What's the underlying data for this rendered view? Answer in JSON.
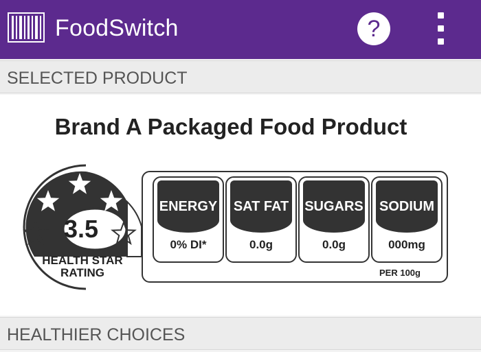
{
  "appbar": {
    "title": "FoodSwitch",
    "help_label": "?"
  },
  "selected": {
    "header": "SELECTED PRODUCT",
    "product_name": "Brand A Packaged Food Product",
    "health_star": {
      "value": "3.5",
      "rating": 3.5,
      "max": 5,
      "label_line1": "HEALTH STAR",
      "label_line2": "RATING"
    },
    "nutrients": [
      {
        "name": "ENERGY",
        "value": "0% DI*"
      },
      {
        "name": "SAT FAT",
        "value": "0.0g"
      },
      {
        "name": "SUGARS",
        "value": "0.0g"
      },
      {
        "name": "SODIUM",
        "value": "000mg"
      }
    ],
    "per_note": "PER 100g"
  },
  "healthier": {
    "header": "HEALTHIER CHOICES"
  },
  "colors": {
    "brand": "#5c2a8e",
    "label": "#333333"
  },
  "icons": {
    "logo": "barcode-icon",
    "help": "help-icon",
    "menu": "overflow-menu-icon"
  }
}
